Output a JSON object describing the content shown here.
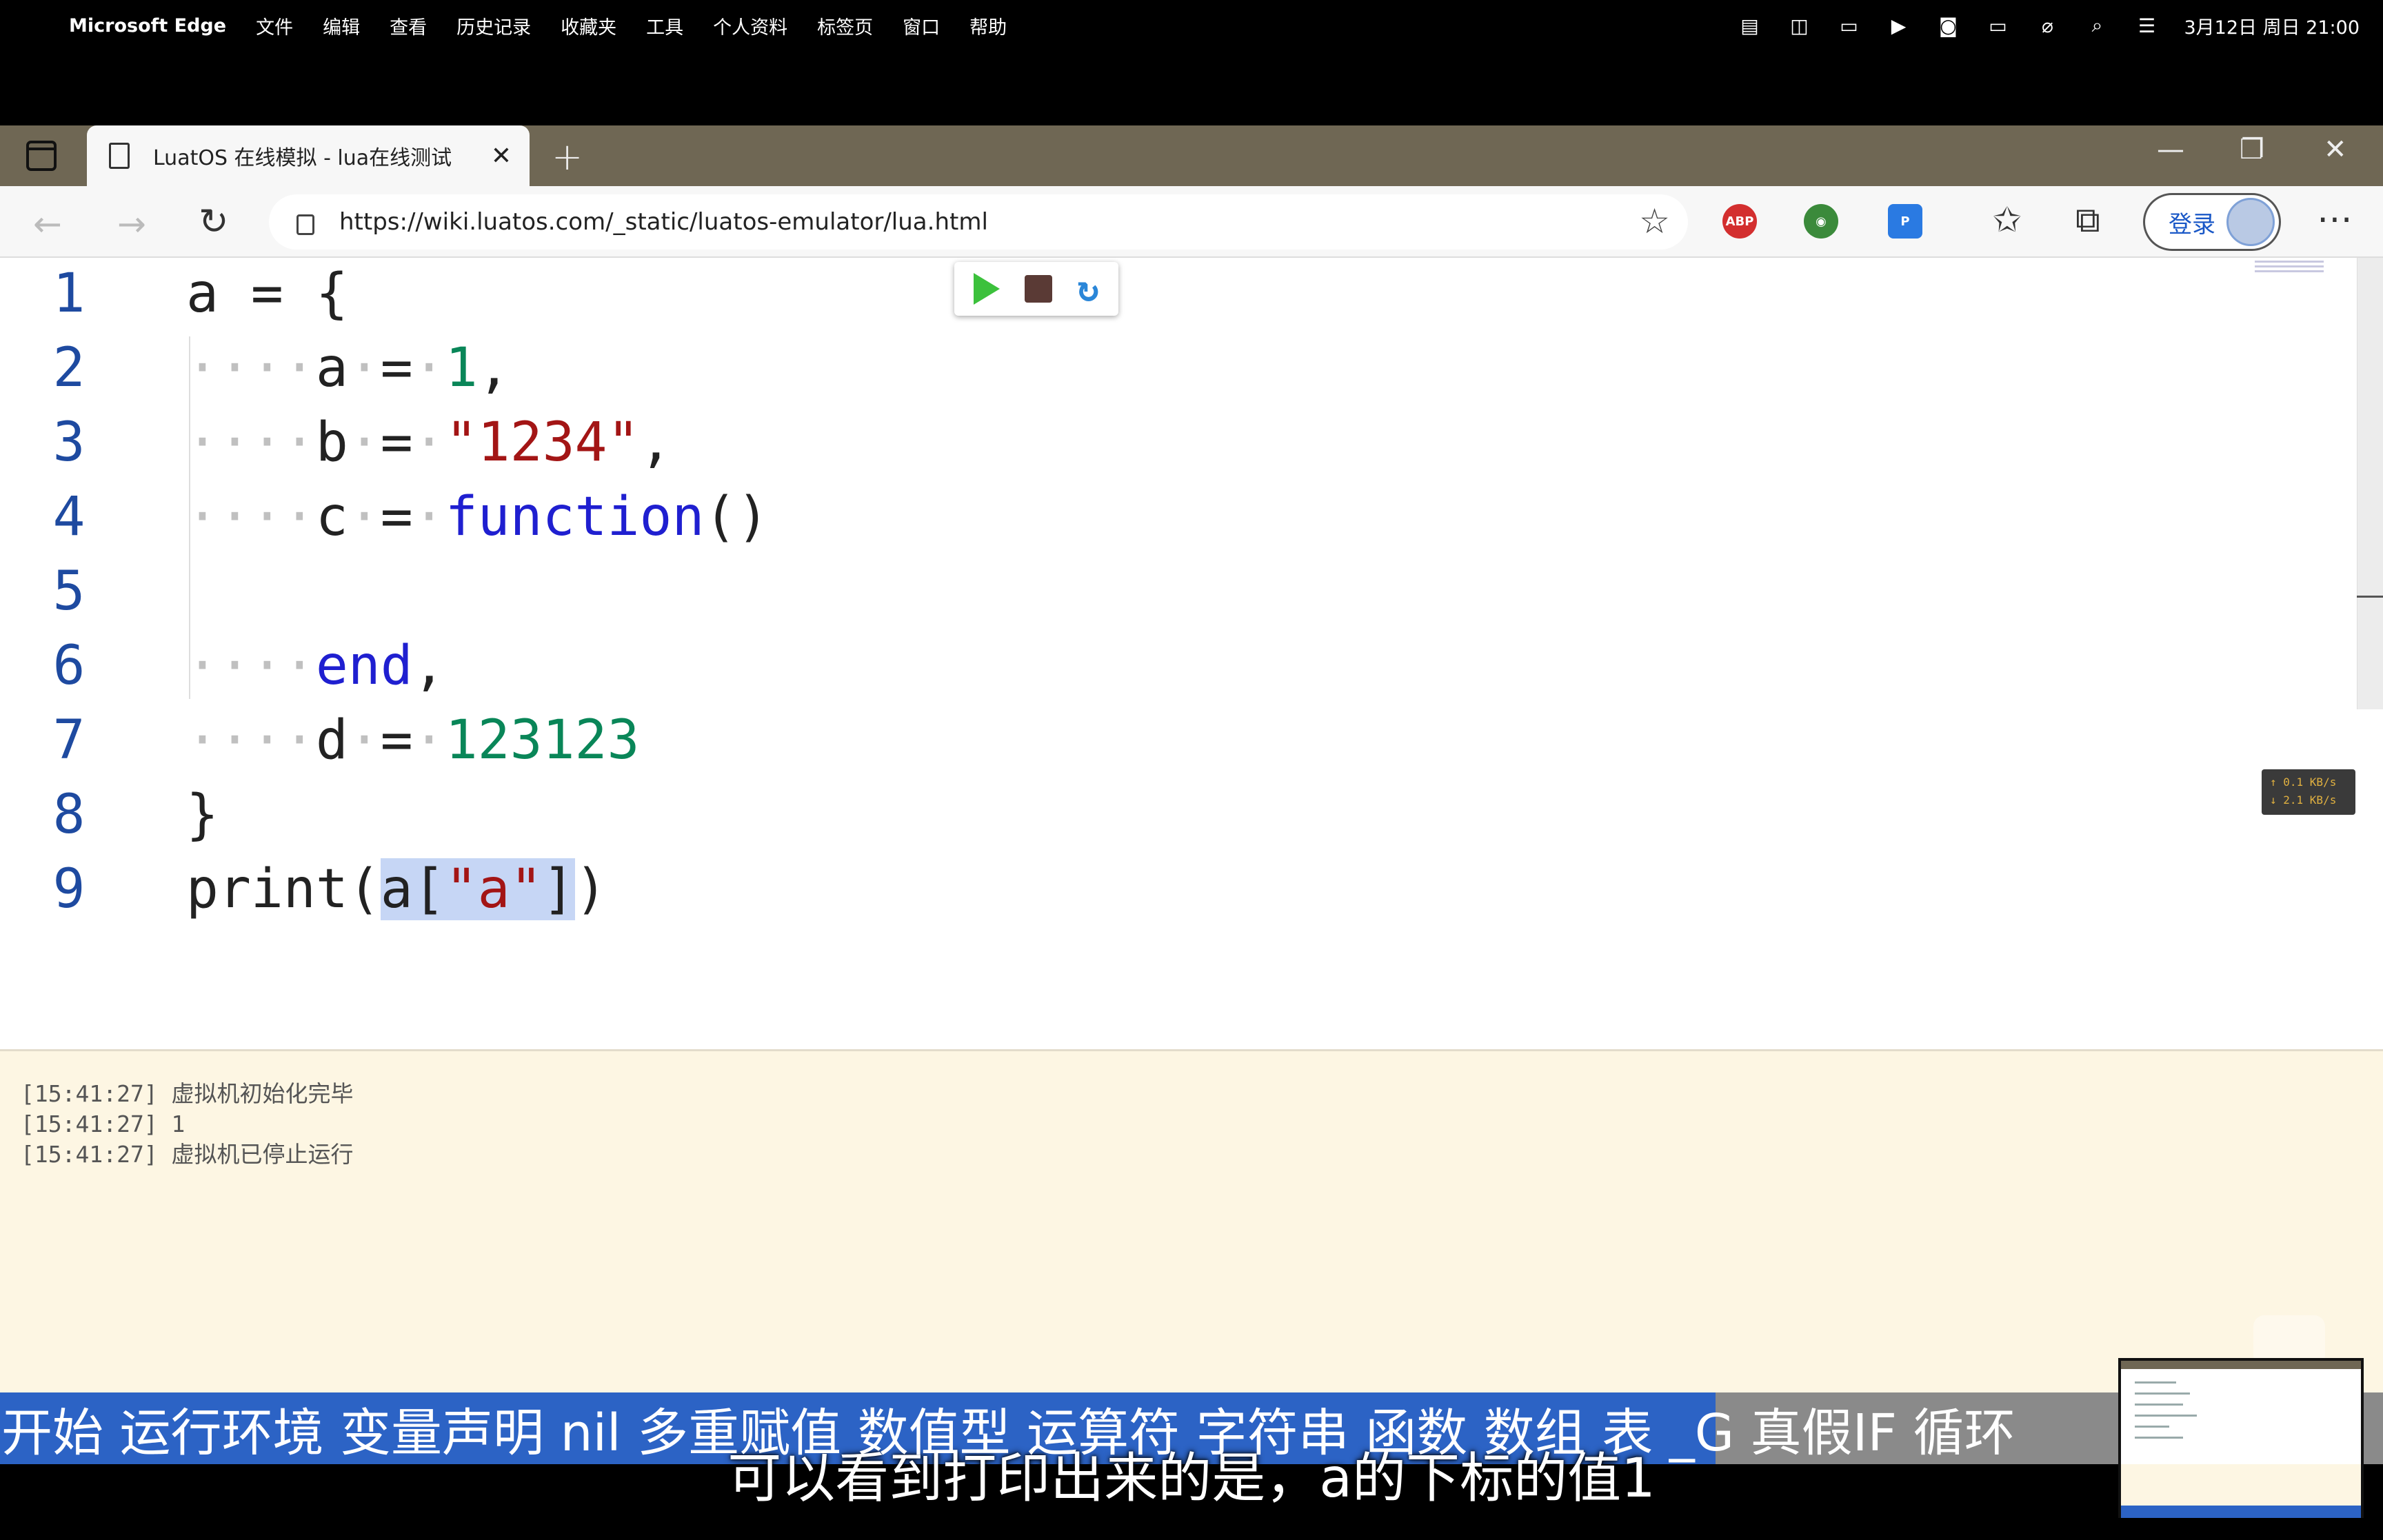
{
  "menubar": {
    "app_name": "Microsoft Edge",
    "items": [
      "文件",
      "编辑",
      "查看",
      "历史记录",
      "收藏夹",
      "工具",
      "个人资料",
      "标签页",
      "窗口",
      "帮助"
    ],
    "clock": "3月12日 周日 21:00",
    "status_icons": [
      "wallet-icon",
      "bookmark-icon",
      "screen-icon",
      "play-icon",
      "du-icon",
      "battery-icon",
      "wifi-off-icon",
      "search-icon",
      "control-center-icon"
    ]
  },
  "browser": {
    "tab_title": "LuatOS 在线模拟 - lua在线测试",
    "url": "https://wiki.luatos.com/_static/luatos-emulator/lua.html",
    "login_label": "登录",
    "abp_label": "ABP"
  },
  "editor": {
    "lines": [
      {
        "n": "1"
      },
      {
        "n": "2"
      },
      {
        "n": "3"
      },
      {
        "n": "4"
      },
      {
        "n": "5"
      },
      {
        "n": "6"
      },
      {
        "n": "7"
      },
      {
        "n": "8"
      },
      {
        "n": "9"
      }
    ],
    "tokens": {
      "l1": "a = {",
      "l2_key": "a",
      "l2_val": "1",
      "l3_key": "b",
      "l3_val": "\"1234\"",
      "l4_key": "c",
      "l4_kw": "function",
      "l4_rest": "()",
      "l6_kw": "end",
      "l7_key": "d",
      "l7_val": "123123",
      "l8": "}",
      "l9_pre": "print(",
      "l9_sel_a": "a[",
      "l9_sel_str": "\"a\"",
      "l9_sel_b": "]",
      "l9_post": ")"
    },
    "netspeed": [
      "↑ 0.1 KB/s",
      "↓ 2.1 KB/s"
    ]
  },
  "console": {
    "lines": [
      "[15:41:27] 虚拟机初始化完毕",
      "[15:41:27] 1",
      "[15:41:27] 虚拟机已停止运行"
    ]
  },
  "video": {
    "chapters": "开始 运行环境 变量声明 nil 多重赋值 数值型 运算符 字符串 函数 数组 表 _G 真假IF 循环",
    "subtitle": "可以看到打印出来的是，a的下标的值1",
    "progress": 0.72
  },
  "colors": {
    "keyword": "#1f1fd0",
    "string": "#a31515",
    "number": "#098658",
    "console_bg": "#fdf6e3",
    "tabstrip": "#6f6754",
    "chapter_progress": "#2c63c5"
  }
}
